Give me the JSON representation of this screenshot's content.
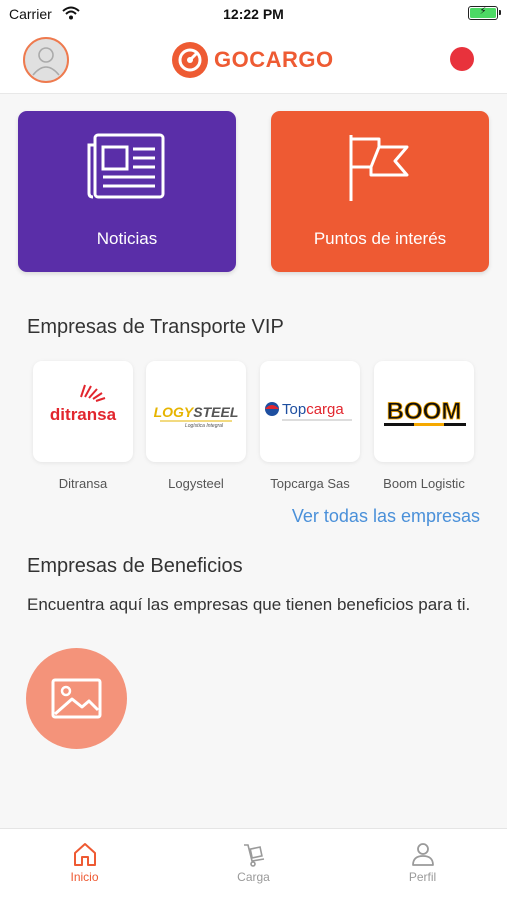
{
  "status_bar": {
    "carrier": "Carrier",
    "time": "12:22 PM"
  },
  "header": {
    "logo_text": "GOCARGO"
  },
  "tiles": [
    {
      "label": "Noticias",
      "icon": "newspaper-icon"
    },
    {
      "label": "Puntos de interés",
      "icon": "flag-icon"
    }
  ],
  "vip": {
    "title": "Empresas de Transporte VIP",
    "companies": [
      {
        "name": "Ditransa",
        "logo_text": "ditransa"
      },
      {
        "name": "Logysteel",
        "logo_text": "LOGYSTEEL",
        "logo_sub": "Logística Integral"
      },
      {
        "name": "Topcarga Sas",
        "logo_text": "Topcarga"
      },
      {
        "name": "Boom Logistic",
        "logo_text": "BOOM"
      }
    ],
    "view_all": "Ver todas las empresas"
  },
  "benefits": {
    "title": "Empresas de Beneficios",
    "description": "Encuentra aquí las empresas que tienen beneficios para ti."
  },
  "tabbar": {
    "tabs": [
      {
        "label": "Inicio",
        "icon": "home-icon",
        "active": true
      },
      {
        "label": "Carga",
        "icon": "cargo-icon",
        "active": false
      },
      {
        "label": "Perfil",
        "icon": "profile-icon",
        "active": false
      }
    ]
  },
  "colors": {
    "brand_orange": "#ee5a33",
    "purple": "#5a2ea8",
    "link_blue": "#4a90d9",
    "benefit_circle": "#f4937a",
    "notification_red": "#e8323c"
  }
}
